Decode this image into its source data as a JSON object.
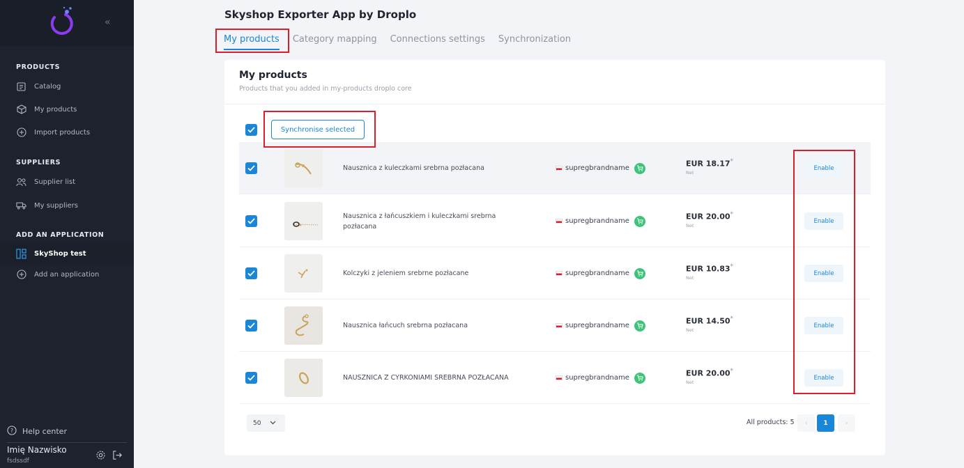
{
  "colors": {
    "accent": "#1a86d8",
    "highlight": "#dd1e2a",
    "cart_icon": "#3ec47a",
    "sidebar_bg": "#1d222e"
  },
  "sidebar": {
    "sections": [
      {
        "title": "PRODUCTS",
        "items": [
          {
            "label": "Catalog",
            "icon": "catalog-icon"
          },
          {
            "label": "My products",
            "icon": "box-icon"
          },
          {
            "label": "Import products",
            "icon": "plus-circle-icon"
          }
        ]
      },
      {
        "title": "SUPPLIERS",
        "items": [
          {
            "label": "Supplier list",
            "icon": "users-icon"
          },
          {
            "label": "My suppliers",
            "icon": "truck-icon"
          }
        ]
      },
      {
        "title": "ADD AN APPLICATION",
        "items": [
          {
            "label": "SkyShop test",
            "icon": "apps-icon",
            "active": true
          },
          {
            "label": "Add an application",
            "icon": "plus-circle-icon"
          }
        ]
      }
    ],
    "help": "Help center",
    "user": {
      "name": "Imię Nazwisko",
      "sub": "fsdssdf"
    }
  },
  "header": {
    "title": "Skyshop Exporter App by Droplo"
  },
  "tabs": [
    {
      "label": "My products",
      "active": true
    },
    {
      "label": "Category mapping"
    },
    {
      "label": "Connections settings"
    },
    {
      "label": "Synchronization"
    }
  ],
  "card": {
    "title": "My products",
    "subtitle": "Products that you added in my-products droplo core",
    "sync_button": "Synchronise selected"
  },
  "products": [
    {
      "name": "Nausznica z kuleczkami srebrna pozłacana",
      "brand": "supregbrandname",
      "price": "EUR 18.17",
      "price_mark": "*",
      "net": "Net",
      "action": "Enable",
      "checked": true
    },
    {
      "name": "Nausznica z łańcuszkiem i kuleczkami srebrna pozłacana",
      "brand": "supregbrandname",
      "price": "EUR 20.00",
      "price_mark": "*",
      "net": "Net",
      "action": "Enable",
      "checked": true
    },
    {
      "name": "Kolczyki z jeleniem srebrne pozłacane",
      "brand": "supregbrandname",
      "price": "EUR 10.83",
      "price_mark": "*",
      "net": "Net",
      "action": "Enable",
      "checked": true
    },
    {
      "name": "Nausznica łańcuch srebrna pozłacana",
      "brand": "supregbrandname",
      "price": "EUR 14.50",
      "price_mark": "*",
      "net": "Net",
      "action": "Enable",
      "checked": true
    },
    {
      "name": "NAUSZNICA Z CYRKONIAMI SREBRNA POZŁACANA",
      "brand": "supregbrandname",
      "price": "EUR 20.00",
      "price_mark": "*",
      "net": "Net",
      "action": "Enable",
      "checked": true
    }
  ],
  "footer": {
    "per_page": "50",
    "all_products": "All products: 5",
    "current_page": "1"
  }
}
